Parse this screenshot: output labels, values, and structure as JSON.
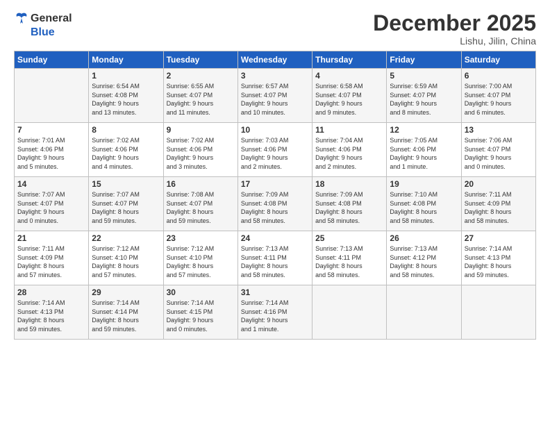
{
  "header": {
    "logo_line1": "General",
    "logo_line2": "Blue",
    "month": "December 2025",
    "location": "Lishu, Jilin, China"
  },
  "days_of_week": [
    "Sunday",
    "Monday",
    "Tuesday",
    "Wednesday",
    "Thursday",
    "Friday",
    "Saturday"
  ],
  "weeks": [
    [
      {
        "day": "",
        "info": ""
      },
      {
        "day": "1",
        "info": "Sunrise: 6:54 AM\nSunset: 4:08 PM\nDaylight: 9 hours\nand 13 minutes."
      },
      {
        "day": "2",
        "info": "Sunrise: 6:55 AM\nSunset: 4:07 PM\nDaylight: 9 hours\nand 11 minutes."
      },
      {
        "day": "3",
        "info": "Sunrise: 6:57 AM\nSunset: 4:07 PM\nDaylight: 9 hours\nand 10 minutes."
      },
      {
        "day": "4",
        "info": "Sunrise: 6:58 AM\nSunset: 4:07 PM\nDaylight: 9 hours\nand 9 minutes."
      },
      {
        "day": "5",
        "info": "Sunrise: 6:59 AM\nSunset: 4:07 PM\nDaylight: 9 hours\nand 8 minutes."
      },
      {
        "day": "6",
        "info": "Sunrise: 7:00 AM\nSunset: 4:07 PM\nDaylight: 9 hours\nand 6 minutes."
      }
    ],
    [
      {
        "day": "7",
        "info": "Sunrise: 7:01 AM\nSunset: 4:06 PM\nDaylight: 9 hours\nand 5 minutes."
      },
      {
        "day": "8",
        "info": "Sunrise: 7:02 AM\nSunset: 4:06 PM\nDaylight: 9 hours\nand 4 minutes."
      },
      {
        "day": "9",
        "info": "Sunrise: 7:02 AM\nSunset: 4:06 PM\nDaylight: 9 hours\nand 3 minutes."
      },
      {
        "day": "10",
        "info": "Sunrise: 7:03 AM\nSunset: 4:06 PM\nDaylight: 9 hours\nand 2 minutes."
      },
      {
        "day": "11",
        "info": "Sunrise: 7:04 AM\nSunset: 4:06 PM\nDaylight: 9 hours\nand 2 minutes."
      },
      {
        "day": "12",
        "info": "Sunrise: 7:05 AM\nSunset: 4:06 PM\nDaylight: 9 hours\nand 1 minute."
      },
      {
        "day": "13",
        "info": "Sunrise: 7:06 AM\nSunset: 4:07 PM\nDaylight: 9 hours\nand 0 minutes."
      }
    ],
    [
      {
        "day": "14",
        "info": "Sunrise: 7:07 AM\nSunset: 4:07 PM\nDaylight: 9 hours\nand 0 minutes."
      },
      {
        "day": "15",
        "info": "Sunrise: 7:07 AM\nSunset: 4:07 PM\nDaylight: 8 hours\nand 59 minutes."
      },
      {
        "day": "16",
        "info": "Sunrise: 7:08 AM\nSunset: 4:07 PM\nDaylight: 8 hours\nand 59 minutes."
      },
      {
        "day": "17",
        "info": "Sunrise: 7:09 AM\nSunset: 4:08 PM\nDaylight: 8 hours\nand 58 minutes."
      },
      {
        "day": "18",
        "info": "Sunrise: 7:09 AM\nSunset: 4:08 PM\nDaylight: 8 hours\nand 58 minutes."
      },
      {
        "day": "19",
        "info": "Sunrise: 7:10 AM\nSunset: 4:08 PM\nDaylight: 8 hours\nand 58 minutes."
      },
      {
        "day": "20",
        "info": "Sunrise: 7:11 AM\nSunset: 4:09 PM\nDaylight: 8 hours\nand 58 minutes."
      }
    ],
    [
      {
        "day": "21",
        "info": "Sunrise: 7:11 AM\nSunset: 4:09 PM\nDaylight: 8 hours\nand 57 minutes."
      },
      {
        "day": "22",
        "info": "Sunrise: 7:12 AM\nSunset: 4:10 PM\nDaylight: 8 hours\nand 57 minutes."
      },
      {
        "day": "23",
        "info": "Sunrise: 7:12 AM\nSunset: 4:10 PM\nDaylight: 8 hours\nand 57 minutes."
      },
      {
        "day": "24",
        "info": "Sunrise: 7:13 AM\nSunset: 4:11 PM\nDaylight: 8 hours\nand 58 minutes."
      },
      {
        "day": "25",
        "info": "Sunrise: 7:13 AM\nSunset: 4:11 PM\nDaylight: 8 hours\nand 58 minutes."
      },
      {
        "day": "26",
        "info": "Sunrise: 7:13 AM\nSunset: 4:12 PM\nDaylight: 8 hours\nand 58 minutes."
      },
      {
        "day": "27",
        "info": "Sunrise: 7:14 AM\nSunset: 4:13 PM\nDaylight: 8 hours\nand 59 minutes."
      }
    ],
    [
      {
        "day": "28",
        "info": "Sunrise: 7:14 AM\nSunset: 4:13 PM\nDaylight: 8 hours\nand 59 minutes."
      },
      {
        "day": "29",
        "info": "Sunrise: 7:14 AM\nSunset: 4:14 PM\nDaylight: 8 hours\nand 59 minutes."
      },
      {
        "day": "30",
        "info": "Sunrise: 7:14 AM\nSunset: 4:15 PM\nDaylight: 9 hours\nand 0 minutes."
      },
      {
        "day": "31",
        "info": "Sunrise: 7:14 AM\nSunset: 4:16 PM\nDaylight: 9 hours\nand 1 minute."
      },
      {
        "day": "",
        "info": ""
      },
      {
        "day": "",
        "info": ""
      },
      {
        "day": "",
        "info": ""
      }
    ]
  ]
}
